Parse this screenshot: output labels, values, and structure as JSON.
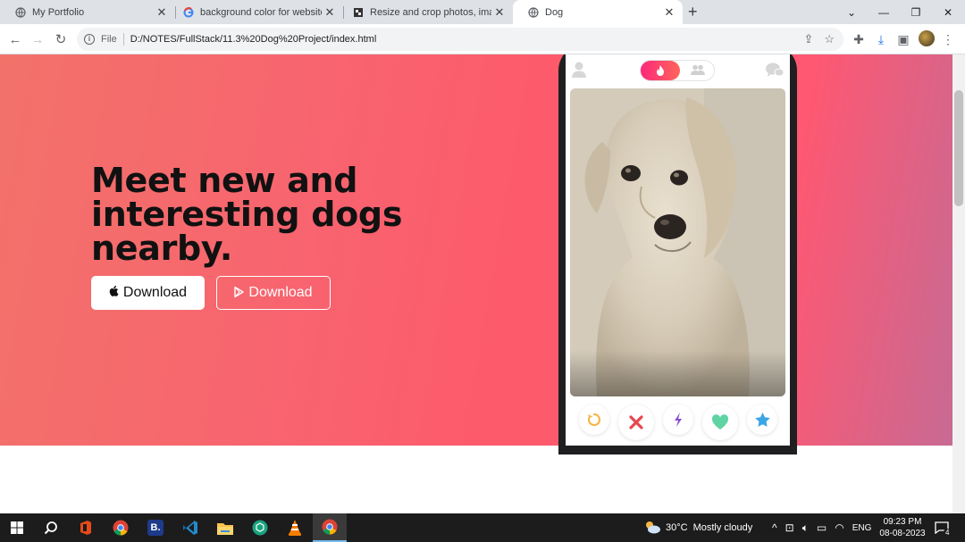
{
  "browser": {
    "tabs": [
      {
        "title": "My Portfolio",
        "icon": "globe-icon"
      },
      {
        "title": "background color for website - G",
        "icon": "google-icon"
      },
      {
        "title": "Resize and crop photos, images a",
        "icon": "image-icon"
      },
      {
        "title": "Dog",
        "icon": "globe-icon",
        "active": true
      }
    ],
    "new_tab": "+",
    "address": {
      "scheme_label": "File",
      "url": "D:/NOTES/FullStack/11.3%20Dog%20Project/index.html"
    }
  },
  "page": {
    "headline": "Meet new and interesting dogs nearby.",
    "buttons": [
      {
        "label": "Download",
        "icon": "apple-icon",
        "style": "light"
      },
      {
        "label": "Download",
        "icon": "play-store-icon",
        "style": "outline"
      }
    ],
    "phone": {
      "toggle_icons": [
        "flame-icon",
        "people-icon"
      ],
      "actions": [
        "rewind-icon",
        "nope-icon",
        "boost-icon",
        "like-icon",
        "super-like-icon"
      ]
    },
    "colors": {
      "gradient_start": "#f2726a",
      "gradient_end": "#c86a93"
    }
  },
  "taskbar": {
    "weather_temp": "30°C",
    "weather_text": "Mostly cloudy",
    "language": "ENG",
    "time": "09:23 PM",
    "date": "08-08-2023",
    "notifications": "4"
  }
}
